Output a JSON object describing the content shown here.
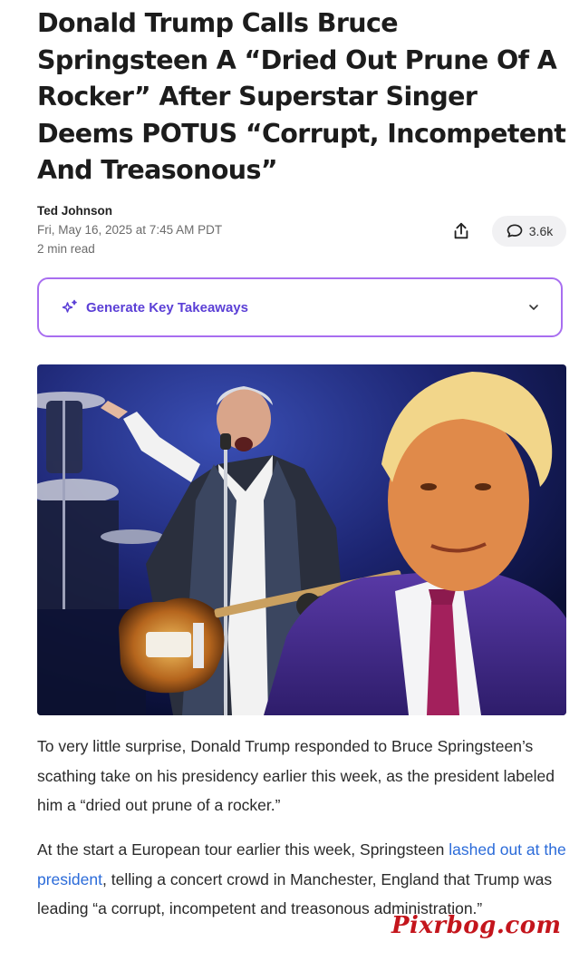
{
  "article": {
    "headline": "Donald Trump Calls Bruce Springsteen A “Dried Out Prune Of A Rocker” After Superstar Singer Deems POTUS “Corrupt, Incompetent And Treasonous”",
    "author": "Ted Johnson",
    "date": "Fri, May 16, 2025 at 7:45 AM PDT",
    "read_time": "2 min read",
    "comment_count": "3.6k"
  },
  "actions": {
    "share_icon": "share-icon",
    "comment_icon": "speech-bubble-icon"
  },
  "takeaways": {
    "label": "Generate Key Takeaways",
    "icon": "sparkle-icon",
    "chevron": "chevron-down-icon",
    "accent": "#a86ef0",
    "text_color": "#5b3fd6"
  },
  "hero_image": {
    "description": "Composite photo: Bruce Springsteen singing and pointing on stage with guitar; Donald Trump smiling in purple suit"
  },
  "body": {
    "p1": "To very little surprise, Donald Trump responded to Bruce Springsteen’s scathing take on his presidency earlier this week, as the president labeled him a “dried out prune of a rocker.”",
    "p2_before": "At the start a European tour earlier this week, Springsteen ",
    "p2_link": "lashed out at the president",
    "p2_after": ", telling a concert crowd in Manchester, England that Trump was leading “a corrupt, incompetent and treasonous administration.”"
  },
  "watermark": "Pixrbog.com",
  "colors": {
    "link": "#2b6bd9",
    "watermark": "#c4151c"
  }
}
